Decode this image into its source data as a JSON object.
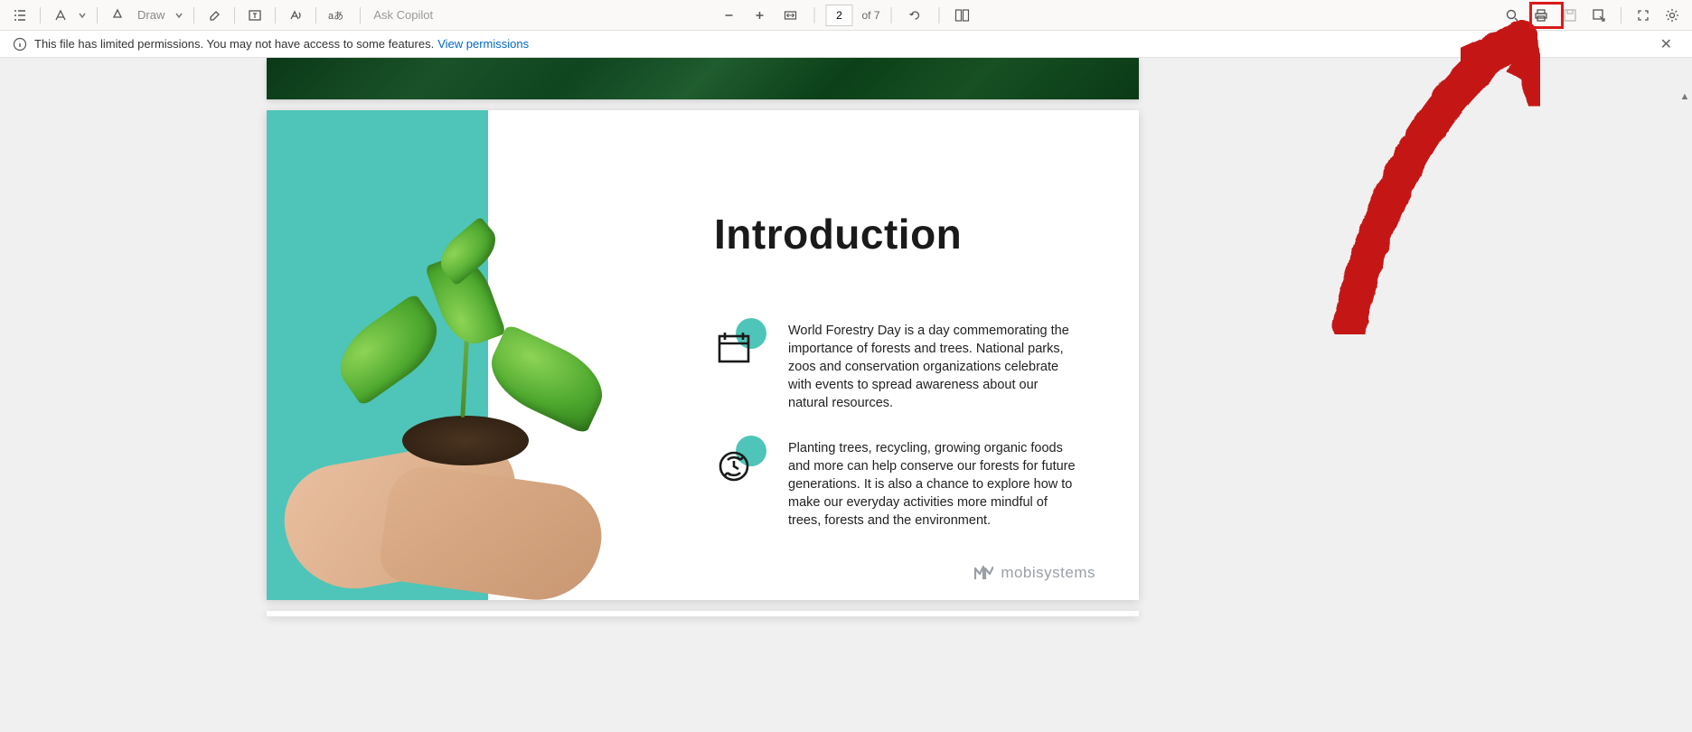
{
  "toolbar": {
    "draw_label": "Draw",
    "copilot_placeholder": "Ask Copilot",
    "page_current": "2",
    "page_total": "of 7"
  },
  "permissions": {
    "message": "This file has limited permissions. You may not have access to some features.",
    "link": "View permissions"
  },
  "slide": {
    "title": "Introduction",
    "para1": "World Forestry Day is a day commemorating the importance of forests and trees. National parks, zoos and conservation organizations celebrate with events to spread awareness about our natural resources.",
    "para2": "Planting trees, recycling, growing organic foods and more can help conserve our forests for future generations. It is also a chance to explore how to make our everyday activities more mindful of trees, forests and the environment.",
    "brand": "mobisystems"
  }
}
